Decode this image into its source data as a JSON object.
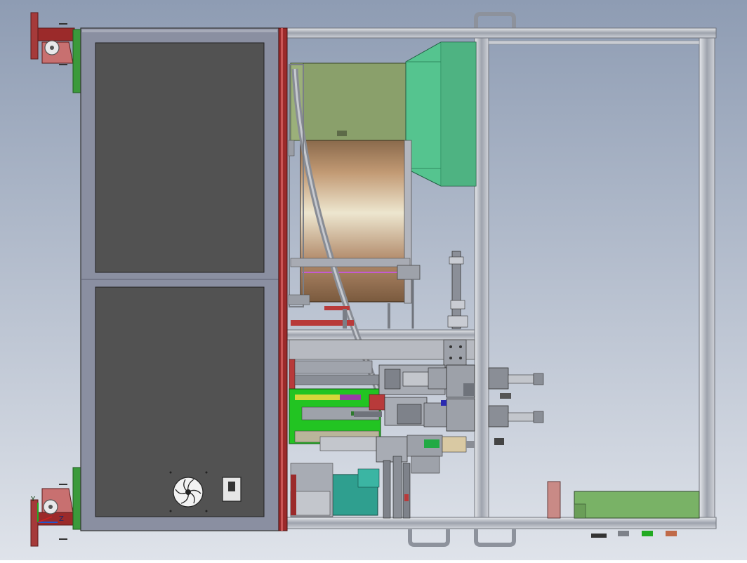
{
  "viewport": {
    "background_top": "#8e9cb3",
    "background_bottom": "#dfe3ea"
  },
  "triad": {
    "y_label": "Y",
    "z_label": "Z"
  },
  "colors": {
    "frame": "#b6bac3",
    "cabinet": "#8a8fa1",
    "panel": "#525252",
    "red_rail": "#9b2a2a",
    "green_mount": "#3b9a3b",
    "olive_block": "#8aa06b",
    "teal_block": "#55c48f",
    "drum_light": "#ede6cf",
    "drum_dark": "#8a6a4c",
    "bright_green": "#22c422",
    "teal_dark": "#2f9f8f",
    "tray_green": "#79b266",
    "hub": "#a85c5c"
  },
  "icons": {
    "fan": "fan-grille-icon",
    "switch": "rocker-switch-icon",
    "caster": "caster-wheel-icon",
    "handle": "handle-icon"
  }
}
